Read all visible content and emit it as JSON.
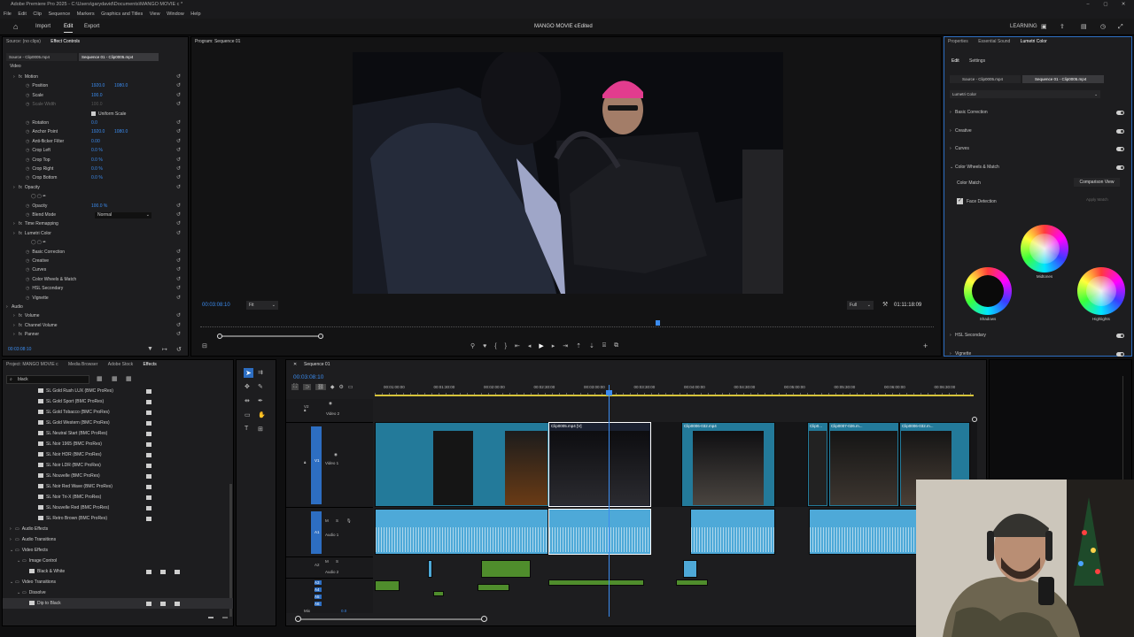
{
  "title_bar": {
    "text": "Adobe Premiere Pro 2025 - C:\\Users\\garydavid\\Documents\\MANGO MOVIE c *"
  },
  "menu": [
    "File",
    "Edit",
    "Clip",
    "Sequence",
    "Markers",
    "Graphics and Titles",
    "View",
    "Window",
    "Help"
  ],
  "workspace": {
    "home_icon": "home-icon",
    "import": "Import",
    "edit": "Edit",
    "export": "Export",
    "project_title": "MANGO MOVIE c",
    "edited": "- Edited",
    "learning": "LEARNING"
  },
  "effect_controls": {
    "tabs": [
      "Source: (no clips)",
      "Effect Controls"
    ],
    "source_tab": "Source - Clip0005.mp4",
    "seq_tab": "Sequence 01 - Clip0005.mp4",
    "video_label": "Video",
    "rows": [
      {
        "label": "Motion",
        "indent": 1,
        "fx": true,
        "v1": "",
        "v2": ""
      },
      {
        "label": "Position",
        "indent": 2,
        "fx": false,
        "v1": "1920.0",
        "v2": "1080.0"
      },
      {
        "label": "Scale",
        "indent": 2,
        "fx": false,
        "v1": "100.0",
        "v2": ""
      },
      {
        "label": "Scale Width",
        "indent": 2,
        "fx": false,
        "v1": "100.0",
        "v2": "",
        "dim": true
      },
      {
        "label": "Uniform Scale",
        "indent": 3,
        "fx": false,
        "v1": "",
        "v2": "",
        "check": true
      },
      {
        "label": "Rotation",
        "indent": 2,
        "fx": false,
        "v1": "0.0",
        "v2": ""
      },
      {
        "label": "Anchor Point",
        "indent": 2,
        "fx": false,
        "v1": "1920.0",
        "v2": "1080.0"
      },
      {
        "label": "Anti-flicker Filter",
        "indent": 2,
        "fx": false,
        "v1": "0.00",
        "v2": ""
      },
      {
        "label": "Crop Left",
        "indent": 2,
        "fx": false,
        "v1": "0.0 %",
        "v2": ""
      },
      {
        "label": "Crop Top",
        "indent": 2,
        "fx": false,
        "v1": "0.0 %",
        "v2": ""
      },
      {
        "label": "Crop Right",
        "indent": 2,
        "fx": false,
        "v1": "0.0 %",
        "v2": ""
      },
      {
        "label": "Crop Bottom",
        "indent": 2,
        "fx": false,
        "v1": "0.0 %",
        "v2": ""
      },
      {
        "label": "Opacity",
        "indent": 1,
        "fx": true,
        "v1": "",
        "v2": ""
      },
      {
        "label": "",
        "indent": 2,
        "fx": false,
        "v1": "",
        "v2": "",
        "masks": true
      },
      {
        "label": "Opacity",
        "indent": 2,
        "fx": false,
        "v1": "100.0 %",
        "v2": ""
      },
      {
        "label": "Blend Mode",
        "indent": 2,
        "fx": false,
        "v1": "",
        "v2": "",
        "blend": "Normal"
      },
      {
        "label": "Time Remapping",
        "indent": 1,
        "fx": true,
        "v1": "",
        "v2": ""
      },
      {
        "label": "Lumetri Color",
        "indent": 1,
        "fx": true,
        "v1": "",
        "v2": ""
      },
      {
        "label": "",
        "indent": 2,
        "fx": false,
        "v1": "",
        "v2": "",
        "masks": true
      },
      {
        "label": "Basic Correction",
        "indent": 2,
        "fx": false,
        "v1": "",
        "v2": ""
      },
      {
        "label": "Creative",
        "indent": 2,
        "fx": false,
        "v1": "",
        "v2": ""
      },
      {
        "label": "Curves",
        "indent": 2,
        "fx": false,
        "v1": "",
        "v2": ""
      },
      {
        "label": "Color Wheels & Match",
        "indent": 2,
        "fx": false,
        "v1": "",
        "v2": ""
      },
      {
        "label": "HSL Secondary",
        "indent": 2,
        "fx": false,
        "v1": "",
        "v2": ""
      },
      {
        "label": "Vignette",
        "indent": 2,
        "fx": false,
        "v1": "",
        "v2": ""
      },
      {
        "label": "Audio",
        "indent": 0,
        "fx": false,
        "v1": "",
        "v2": ""
      },
      {
        "label": "Volume",
        "indent": 1,
        "fx": true,
        "v1": "",
        "v2": ""
      },
      {
        "label": "Channel Volume",
        "indent": 1,
        "fx": true,
        "v1": "",
        "v2": ""
      },
      {
        "label": "Panner",
        "indent": 1,
        "fx": true,
        "v1": "",
        "v2": ""
      }
    ],
    "timecode": "00:03:08:10"
  },
  "program": {
    "title": "Program: Sequence 01",
    "timecode": "00:03:08:10",
    "fit": "Fit",
    "quality": "Full",
    "duration": "01:11:18:09"
  },
  "lumetri": {
    "tabs": [
      "Properties",
      "Essential Sound",
      "Lumetri Color"
    ],
    "subtabs": [
      "Edit",
      "Settings"
    ],
    "source": "Source - Clip0005.mp4",
    "seq": "Sequence 01 - Clip0005.mp4",
    "effect": "Lumetri Color",
    "sections": [
      "Basic Correction",
      "Creative",
      "Curves",
      "Color Wheels & Match"
    ],
    "color_match": "Color Match",
    "comparison_view": "Comparison View",
    "face_detection": "Face Detection",
    "apply_match": "Apply Match",
    "wheels": [
      "Midtones",
      "Shadows",
      "Highlights"
    ],
    "bottom_sections": [
      "HSL Secondary",
      "Vignette"
    ]
  },
  "project": {
    "tabs": [
      "Project: MANGO MOVIE c",
      "Media Browser",
      "Adobe Stock",
      "Effects"
    ],
    "search": "black",
    "presets": [
      "SL Gold Rush LUX (BMC ProRes)",
      "SL Gold Sport (BMC ProRes)",
      "SL Gold Tobacco (BMC ProRes)",
      "SL Gold Western (BMC ProRes)",
      "SL Neutral Start (BMC ProRes)",
      "SL Noir 1965 (BMC ProRes)",
      "SL Noir HDR (BMC ProRes)",
      "SL Noir LDR (BMC ProRes)",
      "SL Nouvelle (BMC ProRes)",
      "SL Noir Red Wave (BMC ProRes)",
      "SL Noir Tri-X (BMC ProRes)",
      "SL Nouvelle Red (BMC ProRes)",
      "SL Retro Brown (BMC ProRes)"
    ],
    "folders": [
      {
        "label": "Audio Effects",
        "indent": 0
      },
      {
        "label": "Audio Transitions",
        "indent": 0
      },
      {
        "label": "Video Effects",
        "indent": 0
      },
      {
        "label": "Image Control",
        "indent": 1
      },
      {
        "label": "Black & White",
        "indent": 2,
        "fx": true
      },
      {
        "label": "Video Transitions",
        "indent": 0
      },
      {
        "label": "Dissolve",
        "indent": 1
      },
      {
        "label": "Dip to Black",
        "indent": 2,
        "fx": true,
        "sel": true
      }
    ]
  },
  "timeline": {
    "title": "Sequence 01",
    "timecode": "00:03:08:10",
    "ruler": [
      "00:01:00:00",
      "00:01:30:00",
      "00:02:00:00",
      "00:02:30:00",
      "00:03:00:00",
      "00:03:30:00",
      "00:04:00:00",
      "00:04:30:00",
      "00:05:00:00",
      "00:05:30:00",
      "00:06:00:00",
      "00:06:30:00"
    ],
    "tracks": {
      "v2": "V2",
      "video2": "Video 2",
      "v1": "V1",
      "video1": "Video 1",
      "a1": "A1",
      "audio1": "Audio 1",
      "a2": "A2",
      "audio2": "Audio 2",
      "a3": "A3",
      "a4": "A4",
      "a5": "A5",
      "a6": "A6",
      "mix": "Mix",
      "mixval": "0.0"
    },
    "clips": [
      "Clip0005.mp4 [V]",
      "Clip0006-032.mp4",
      "Clip0...",
      "Clip0007-026.m...",
      "Clip0006-032.m..."
    ]
  },
  "colors": {
    "accent": "#3b8cf0",
    "clip_video": "#237a9a",
    "clip_audio": "#4ea9d8",
    "clip_green": "#4f8d2c"
  }
}
